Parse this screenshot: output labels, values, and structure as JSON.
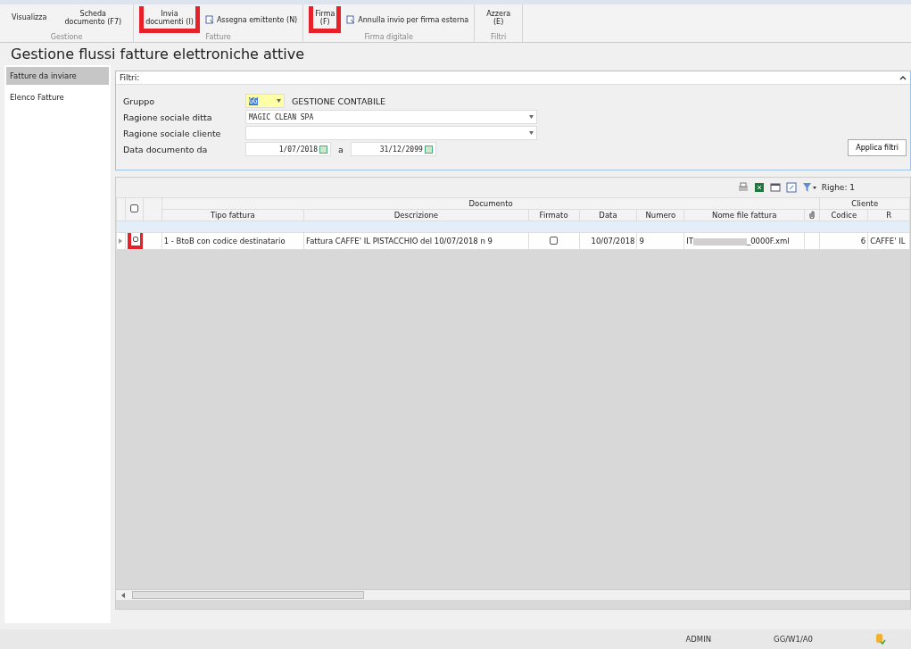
{
  "ribbon": {
    "groups": [
      {
        "label": "Gestione",
        "buttons": [
          {
            "label": "Visualizza",
            "highlighted": false
          },
          {
            "label": "Scheda\ndocumento (F7)",
            "highlighted": false
          }
        ]
      },
      {
        "label": "Fatture",
        "buttons": [
          {
            "label": "Invia\ndocumenti (I)",
            "highlighted": true
          }
        ],
        "items": [
          "Assegna emittente (N)"
        ]
      },
      {
        "label": "Firma digitale",
        "buttons": [
          {
            "label": "Firma\n(F)",
            "highlighted": true
          }
        ],
        "items": [
          "Annulla invio per firma esterna"
        ]
      },
      {
        "label": "Filtri",
        "buttons": [
          {
            "label": "Azzera\n(E)",
            "highlighted": false
          }
        ]
      }
    ]
  },
  "page_title": "Gestione flussi fatture elettroniche attive",
  "sidebar": {
    "items": [
      {
        "label": "Fatture da inviare",
        "selected": true
      },
      {
        "label": "Elenco Fatture",
        "selected": false
      }
    ]
  },
  "filters": {
    "title": "Filtri:",
    "gruppo_label": "Gruppo",
    "gruppo_value": "GG",
    "gruppo_desc": "GESTIONE CONTABILE",
    "ditta_label": "Ragione sociale ditta",
    "ditta_value": "MAGIC CLEAN SPA",
    "cliente_label": "Ragione sociale cliente",
    "data_label": "Data documento da",
    "data_from": "1/07/2018",
    "data_sep": "a",
    "data_to": "31/12/2099",
    "apply": "Applica filtri"
  },
  "grid": {
    "rows_label": "Righe: 1",
    "all_checked": false,
    "group_headers": [
      "Documento",
      "Cliente"
    ],
    "columns": [
      "Tipo fattura",
      "Descrizione",
      "Firmato",
      "Data",
      "Numero",
      "Nome file fattura",
      "Codice",
      "R"
    ],
    "rows": [
      {
        "highlighted": true,
        "checked": false,
        "tipo": "1 - BtoB con codice destinatario",
        "descrizione": "Fattura CAFFE' IL PISTACCHIO del 10/07/2018 n 9",
        "firmato": false,
        "data": "10/07/2018",
        "numero": "9",
        "file_prefix": "IT",
        "file_suffix": "_0000F.xml",
        "codice": "6",
        "cliente": "CAFFE' IL"
      }
    ]
  },
  "status_bar": {
    "user": "ADMIN",
    "path": "GG/W1/A0"
  }
}
